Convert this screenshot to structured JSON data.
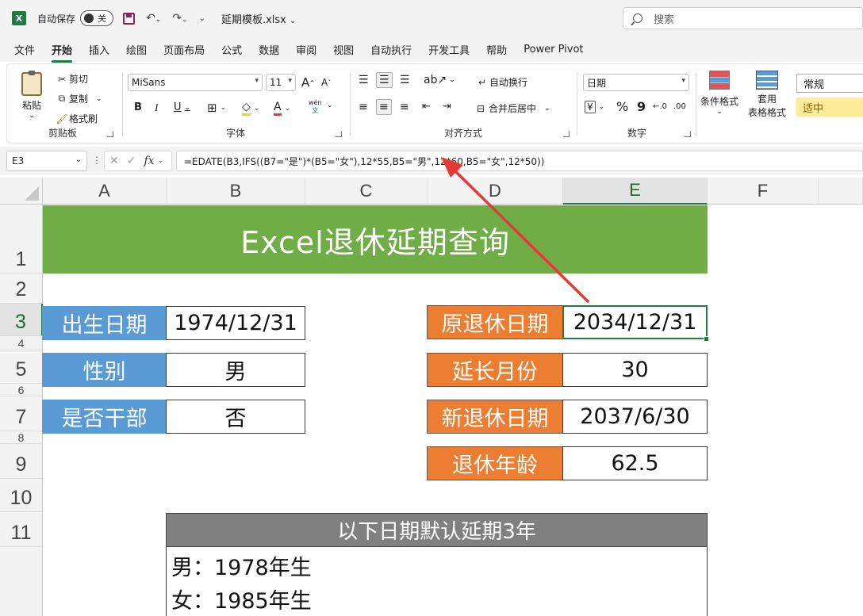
{
  "app": {
    "logo_letter": "X",
    "autosave_label": "自动保存",
    "autosave_state": "关",
    "filename": "延期模板.xlsx",
    "search_placeholder": "搜索"
  },
  "tabs": [
    "文件",
    "开始",
    "插入",
    "绘图",
    "页面布局",
    "公式",
    "数据",
    "审阅",
    "视图",
    "自动执行",
    "开发工具",
    "帮助",
    "Power Pivot"
  ],
  "active_tab": "开始",
  "ribbon": {
    "clipboard": {
      "paste": "粘贴",
      "cut": "剪切",
      "copy": "复制",
      "format_painter": "格式刷",
      "group": "剪贴板"
    },
    "font": {
      "name": "MiSans",
      "size": "11",
      "group": "字体",
      "bold": "B",
      "italic": "I",
      "underline": "U",
      "grow": "A",
      "shrink": "A",
      "phonetic_top": "wén",
      "phonetic_bottom": "文"
    },
    "alignment": {
      "wrap": "自动换行",
      "merge": "合并后居中",
      "group": "对齐方式"
    },
    "number": {
      "format": "日期",
      "group": "数字",
      "percent": "%",
      "comma": "9"
    },
    "styles": {
      "conditional": "条件格式",
      "table_line1": "套用",
      "table_line2": "表格格式",
      "normal": "常规",
      "medium": "适中"
    }
  },
  "formula_bar": {
    "name_box": "E3",
    "formula": "=EDATE(B3,IFS((B7=\"是\")*(B5=\"女\"),12*55,B5=\"男\",12*60,B5=\"女\",12*50))"
  },
  "columns": [
    "A",
    "B",
    "C",
    "D",
    "E",
    "F"
  ],
  "rows": [
    "1",
    "2",
    "3",
    "4",
    "5",
    "6",
    "7",
    "8",
    "9",
    "10",
    "11"
  ],
  "sheet": {
    "title": "Excel退休延期查询",
    "birth_label": "出生日期",
    "birth_value": "1974/12/31",
    "gender_label": "性别",
    "gender_value": "男",
    "cadre_label": "是否干部",
    "cadre_value": "否",
    "orig_label": "原退休日期",
    "orig_value": "2034/12/31",
    "extend_label": "延长月份",
    "extend_value": "30",
    "new_label": "新退休日期",
    "new_value": "2037/6/30",
    "age_label": "退休年龄",
    "age_value": "62.5",
    "note_header": "以下日期默认延期3年",
    "note_male": "男：1978年生",
    "note_female": "女：1985年生"
  },
  "colors": {
    "banner": "#70ad47",
    "blue_label": "#5b9bd5",
    "orange_label": "#ed7d31",
    "gray_header": "#808080",
    "accent": "#1f7a43",
    "arrow": "#e53935"
  }
}
